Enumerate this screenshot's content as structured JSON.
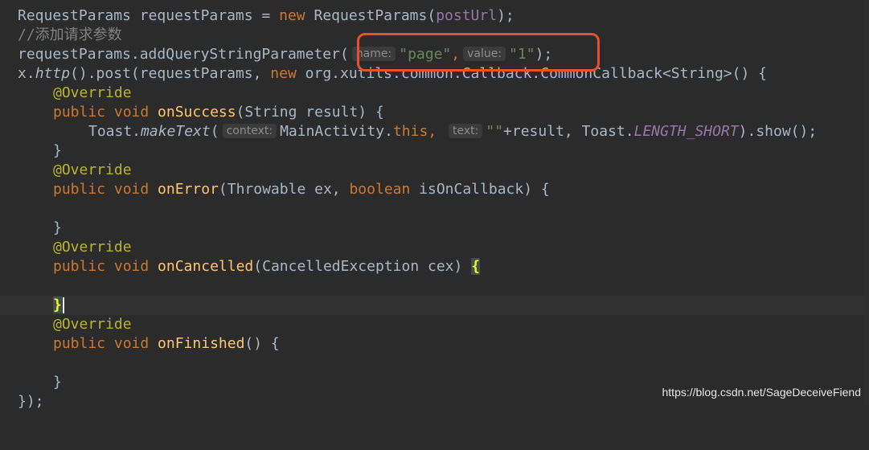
{
  "editor": {
    "tokens": {
      "l1_cls": "RequestParams",
      "l1_var": " requestParams = ",
      "l1_new": "new",
      "l1_cls2": " RequestParams(",
      "l1_arg": "postUrl",
      "l1_end": ");",
      "l2_comment": "//添加请求参数",
      "l3_call": "requestParams.addQueryStringParameter(",
      "l3_hint_name": "name:",
      "l3_str_page": "\"page\"",
      "l3_comma": ",",
      "l3_hint_value": "value:",
      "l3_str_one": "\"1\"",
      "l3_end": ");",
      "l4_x": "x.",
      "l4_http": "http",
      "l4_post": "().post(requestParams, ",
      "l4_new": "new",
      "l4_rest": " org.xutils.common.Callback.CommonCallback<String>() {",
      "l5_ann": "@Override",
      "l6_kw": "public void ",
      "l6_fn": "onSuccess",
      "l6_rest": "(String result) {",
      "l7_toast": "Toast.",
      "l7_make": "makeText",
      "l7_paren": "(",
      "l7_hint_context": "context:",
      "l7_main": "MainActivity.",
      "l7_this": "this",
      "l7_comma": ", ",
      "l7_hint_text": "text:",
      "l7_empty": "\"\"",
      "l7_plus": "+result, Toast.",
      "l7_field": "LENGTH_SHORT",
      "l7_end": ").show();",
      "l8_brace": "}",
      "l9_ann": "@Override",
      "l10_kw": "public void ",
      "l10_fn": "onError",
      "l10_mid": "(Throwable ex, ",
      "l10_bool": "boolean",
      "l10_end": " isOnCallback) {",
      "l12_brace": "}",
      "l13_ann": "@Override",
      "l14_kw": "public void ",
      "l14_fn": "onCancelled",
      "l14_mid": "(CancelledException cex) ",
      "l14_brace": "{",
      "l16_brace": "}",
      "l17_ann": "@Override",
      "l18_kw": "public void ",
      "l18_fn": "onFinished",
      "l18_end": "() {",
      "l20_brace": "}",
      "l21_end": "});"
    }
  },
  "watermark": "https://blog.csdn.net/SageDeceiveFiend",
  "colors": {
    "background": "#2b2b2b",
    "keyword": "#cc7832",
    "method": "#ffc66d",
    "string": "#6a8759",
    "annotation": "#bbb529",
    "highlight_box": "#e2522c"
  }
}
